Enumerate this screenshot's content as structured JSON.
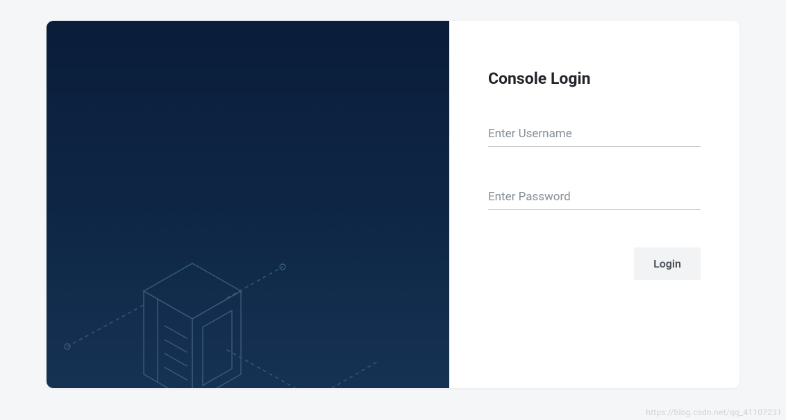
{
  "login": {
    "title": "Console Login",
    "username_placeholder": "Enter Username",
    "password_placeholder": "Enter Password",
    "username_value": "",
    "password_value": "",
    "submit_label": "Login"
  },
  "watermark": "https://blog.csdn.net/qq_41107231",
  "illustration": {
    "icon": "server-cube-icon"
  }
}
